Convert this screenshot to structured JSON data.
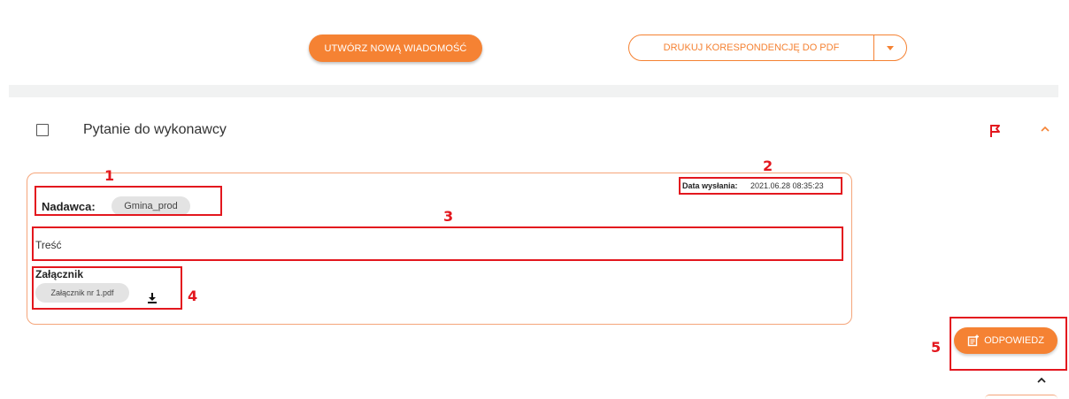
{
  "toolbar": {
    "new_message_label": "UTWÓRZ NOWĄ WIADOMOŚĆ",
    "print_label": "DRUKUJ KORESPONDENCJĘ DO PDF"
  },
  "message": {
    "subject": "Pytanie do wykonawcy",
    "sender_label": "Nadawca:",
    "sender_value": "Gmina_prod",
    "date_label": "Data wysłania:",
    "date_value": "2021.06.28 08:35:23",
    "content": "Treść",
    "attachment_label": "Załącznik",
    "attachment_file": "Załącznik nr 1.pdf"
  },
  "reply": {
    "label": "ODPOWIEDZ"
  },
  "annotations": {
    "n1": "1",
    "n2": "2",
    "n3": "3",
    "n4": "4",
    "n5": "5"
  },
  "colors": {
    "accent": "#f58233",
    "annotation": "#e3171e",
    "flag": "#e3171e"
  },
  "icons": [
    "caret-down-icon",
    "checkbox-icon",
    "flag-icon",
    "chevron-up-icon",
    "download-icon",
    "reply-icon"
  ]
}
